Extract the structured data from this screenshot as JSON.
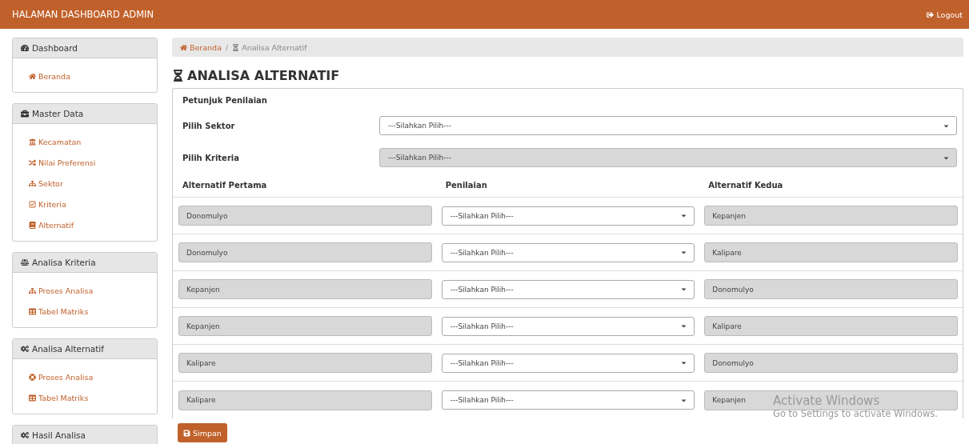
{
  "header": {
    "title": "HALAMAN DASHBOARD ADMIN",
    "logout": "Logout"
  },
  "sidebar": [
    {
      "title": "Dashboard",
      "items": [
        {
          "label": "Beranda"
        }
      ]
    },
    {
      "title": "Master Data",
      "items": [
        {
          "label": "Kecamatan"
        },
        {
          "label": "Nilai Preferensi"
        },
        {
          "label": "Sektor"
        },
        {
          "label": "Kriteria"
        },
        {
          "label": "Alternatif"
        }
      ]
    },
    {
      "title": "Analisa Kriteria",
      "items": [
        {
          "label": "Proses Analisa"
        },
        {
          "label": "Tabel Matriks"
        }
      ]
    },
    {
      "title": "Analisa Alternatif",
      "items": [
        {
          "label": "Proses Analisa"
        },
        {
          "label": "Tabel Matriks"
        }
      ]
    },
    {
      "title": "Hasil Analisa"
    }
  ],
  "breadcrumb": {
    "separator": "/",
    "items": [
      {
        "label": "Beranda",
        "kind": "link"
      },
      {
        "label": "Analisa Alternatif",
        "kind": "current"
      }
    ]
  },
  "page_title": "ANALISA ALTERNATIF",
  "form": {
    "heading": "Petunjuk Penilaian",
    "fields": [
      {
        "label": "Pilih Sektor",
        "value": "---Silahkan Pilih---",
        "disabled": false
      },
      {
        "label": "Pilih Kriteria",
        "value": "---Silahkan Pilih---",
        "disabled": true
      }
    ],
    "columns": [
      "Alternatif Pertama",
      "Penilaian",
      "Alternatif Kedua"
    ],
    "rows": [
      {
        "first": "Donomulyo",
        "rating": "---Silahkan Pilih---",
        "second": "Kepanjen"
      },
      {
        "first": "Donomulyo",
        "rating": "---Silahkan Pilih---",
        "second": "Kalipare"
      },
      {
        "first": "Kepanjen",
        "rating": "---Silahkan Pilih---",
        "second": "Donomulyo"
      },
      {
        "first": "Kepanjen",
        "rating": "---Silahkan Pilih---",
        "second": "Kalipare"
      },
      {
        "first": "Kalipare",
        "rating": "---Silahkan Pilih---",
        "second": "Donomulyo"
      },
      {
        "first": "Kalipare",
        "rating": "---Silahkan Pilih---",
        "second": "Kepanjen"
      }
    ],
    "save_button": "Simpan"
  },
  "os_overlay": {
    "title": "Activate Windows",
    "subtitle": "Go to Settings to activate Windows."
  }
}
